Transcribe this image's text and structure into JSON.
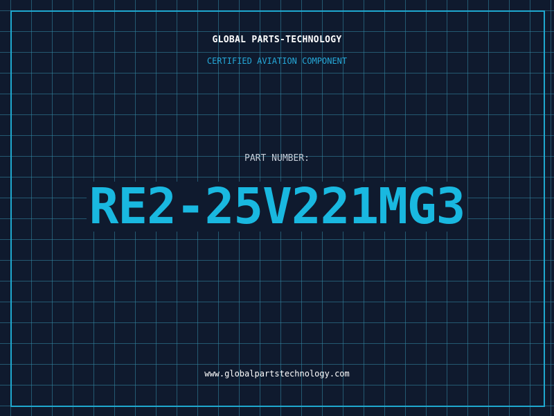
{
  "header": {
    "company_name": "GLOBAL PARTS-TECHNOLOGY",
    "tagline": "CERTIFIED AVIATION COMPONENT"
  },
  "part": {
    "label": "PART NUMBER:",
    "number": "RE2-25V221MG3"
  },
  "footer": {
    "website": "www.globalpartstechnology.com"
  },
  "colors": {
    "background": "#0f1a2e",
    "grid": "#348ca8",
    "frame": "#1fa8cf",
    "accent": "#19b8e0",
    "subtitle": "#25a8d8",
    "label": "#c5cdd8",
    "text": "#ffffff"
  }
}
